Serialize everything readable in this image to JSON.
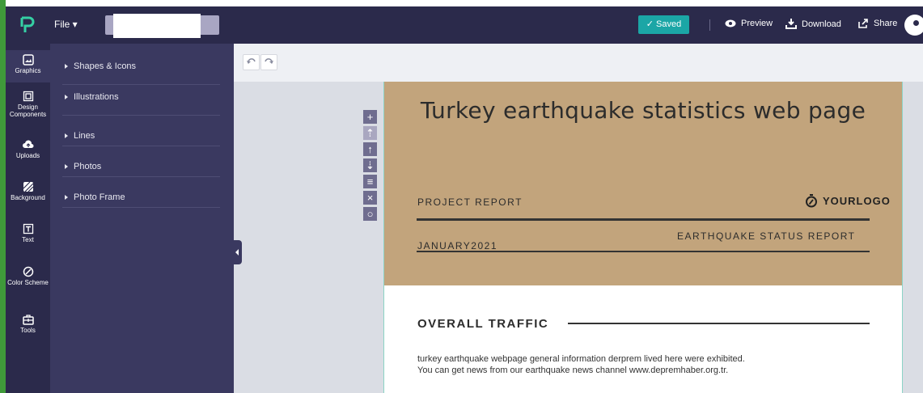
{
  "topbar": {
    "file_label": "File ▾",
    "saved_label": "✓ Saved",
    "preview_label": "Preview",
    "download_label": "Download",
    "share_label": "Share"
  },
  "rail": {
    "items": [
      {
        "label": "Graphics",
        "icon": "image-icon"
      },
      {
        "label": "Design Components",
        "icon": "components-icon"
      },
      {
        "label": "Uploads",
        "icon": "cloud-upload-icon"
      },
      {
        "label": "Background",
        "icon": "background-icon"
      },
      {
        "label": "Text",
        "icon": "text-icon"
      },
      {
        "label": "Color Scheme",
        "icon": "palette-icon"
      },
      {
        "label": "Tools",
        "icon": "toolbox-icon"
      }
    ]
  },
  "panel": {
    "categories": [
      "Shapes & Icons",
      "Illustrations",
      "Lines",
      "Photos",
      "Photo Frame"
    ]
  },
  "canvas": {
    "title": "Turkey earthquake statistics web page",
    "project_report": "PROJECT REPORT",
    "logo_text": "YOURLOGO",
    "status_report": "EARTHQUAKE STATUS REPORT",
    "date": "JANUARY2021",
    "section_title": "OVERALL TRAFFIC",
    "body_line1": "turkey earthquake webpage general information derprem lived here were exhibited.",
    "body_line2": "You can get news from our earthquake news channel www.depremhaber.org.tr."
  },
  "colors": {
    "topbar": "#2b2a4b",
    "panel": "#3a3960",
    "saved": "#1ba6a6",
    "banner": "#c2a47c",
    "edge": "#3f9a3a"
  }
}
